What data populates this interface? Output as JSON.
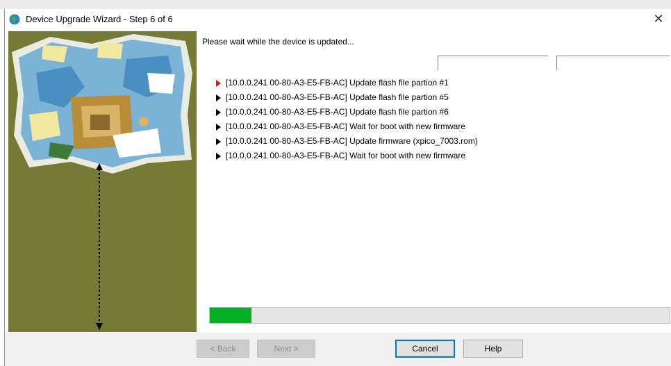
{
  "window": {
    "title": "Device Upgrade Wizard - Step 6 of 6",
    "close_symbol": "✕"
  },
  "main": {
    "status_text": "Please wait while the device is updated...",
    "log": [
      {
        "text": "[10.0.0.241 00-80-A3-E5-FB-AC] Update flash file partion #1",
        "active": true
      },
      {
        "text": "[10.0.0.241 00-80-A3-E5-FB-AC] Update flash file partion #5",
        "active": false
      },
      {
        "text": "[10.0.0.241 00-80-A3-E5-FB-AC] Update flash file partion #6",
        "active": false
      },
      {
        "text": "[10.0.0.241 00-80-A3-E5-FB-AC] Wait for boot with new firmware",
        "active": false
      },
      {
        "text": "[10.0.0.241 00-80-A3-E5-FB-AC] Update firmware (xpico_7003.rom)",
        "active": false
      },
      {
        "text": "[10.0.0.241 00-80-A3-E5-FB-AC] Wait for boot with new firmware",
        "active": false
      }
    ],
    "progress_percent": 9
  },
  "buttons": {
    "back": "< Back",
    "next": "Next >",
    "cancel": "Cancel",
    "help": "Help"
  },
  "icons": {
    "app": "globe-icon",
    "active_step": "red-arrow-icon",
    "pending_step": "black-arrow-icon",
    "close": "close-icon"
  },
  "colors": {
    "sidebar": "#757a35",
    "progress_fill": "#06b025",
    "active_arrow": "#e81010"
  }
}
